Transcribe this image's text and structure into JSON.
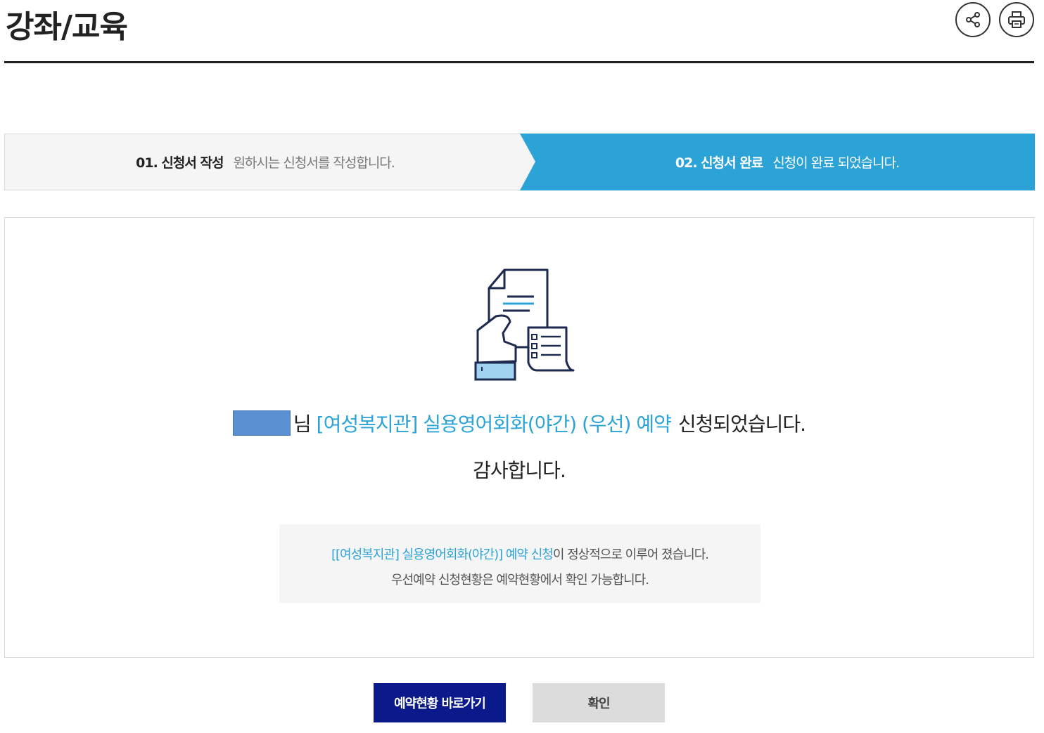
{
  "header": {
    "title": "강좌/교육",
    "share_icon": "share-icon",
    "print_icon": "print-icon"
  },
  "steps": [
    {
      "number": "01. 신청서 작성",
      "description": "원하시는 신청서를 작성합니다.",
      "active": false
    },
    {
      "number": "02. 신청서 완료",
      "description": "신청이 완료 되었습니다.",
      "active": true
    }
  ],
  "colors": {
    "accent": "#2ba3d6",
    "step_active_bg": "#2ba3d6",
    "primary_button": "#0a1a8a",
    "secondary_button": "#dcdcdc",
    "redaction": "#5b8fd4"
  },
  "result": {
    "illustration_icon": "application-document-icon",
    "name_suffix": "님",
    "course": "[여성복지관] 실용영어회화(야간) (우선) 예약",
    "message_tail": "신청되었습니다.",
    "thanks": "감사합니다.",
    "notice": {
      "highlight": "[[여성복지관] 실용영어회화(야간)] 예약 신청",
      "line1_rest": "이 정상적으로 이루어 졌습니다.",
      "line2": "우선예약 신청현황은 예약현황에서 확인 가능합니다."
    }
  },
  "buttons": {
    "status": "예약현황 바로가기",
    "confirm": "확인"
  }
}
